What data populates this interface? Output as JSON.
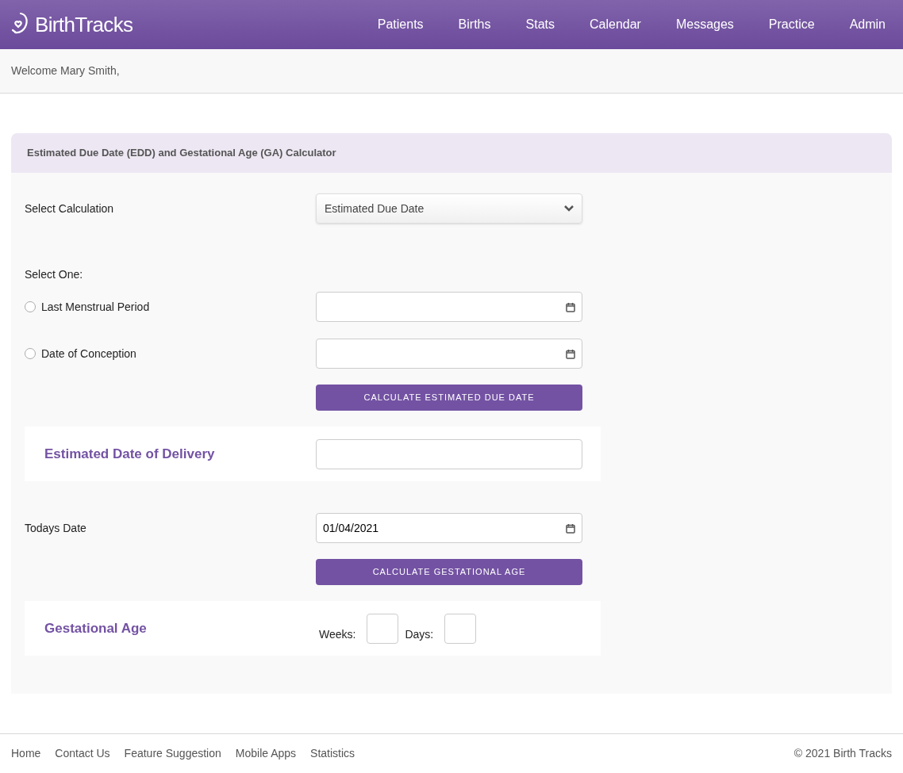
{
  "header": {
    "logo": "BirthTracks",
    "nav": [
      {
        "label": "Patients"
      },
      {
        "label": "Births"
      },
      {
        "label": "Stats"
      },
      {
        "label": "Calendar"
      },
      {
        "label": "Messages"
      },
      {
        "label": "Practice"
      },
      {
        "label": "Admin"
      }
    ]
  },
  "welcome": "Welcome Mary Smith,",
  "calculator": {
    "title": "Estimated Due Date (EDD) and Gestational Age (GA) Calculator",
    "select_label": "Select Calculation",
    "select_value": "Estimated Due Date",
    "select_one": "Select One:",
    "options": [
      {
        "label": "Last Menstrual Period",
        "selected": false
      },
      {
        "label": "Date of Conception",
        "selected": false
      }
    ],
    "edd_button": "CALCULATE ESTIMATED DUE DATE",
    "edd_label": "Estimated Date of Delivery",
    "today_label": "Todays Date",
    "today_value": "01/04/2021",
    "ga_button": "CALCULATE GESTATIONAL AGE",
    "ga_label": "Gestational Age",
    "weeks_label": "Weeks:",
    "days_label": "Days:"
  },
  "footer": {
    "links": [
      "Home",
      "Contact Us",
      "Feature Suggestion",
      "Mobile Apps",
      "Statistics"
    ],
    "copyright": "© 2021 Birth Tracks"
  }
}
